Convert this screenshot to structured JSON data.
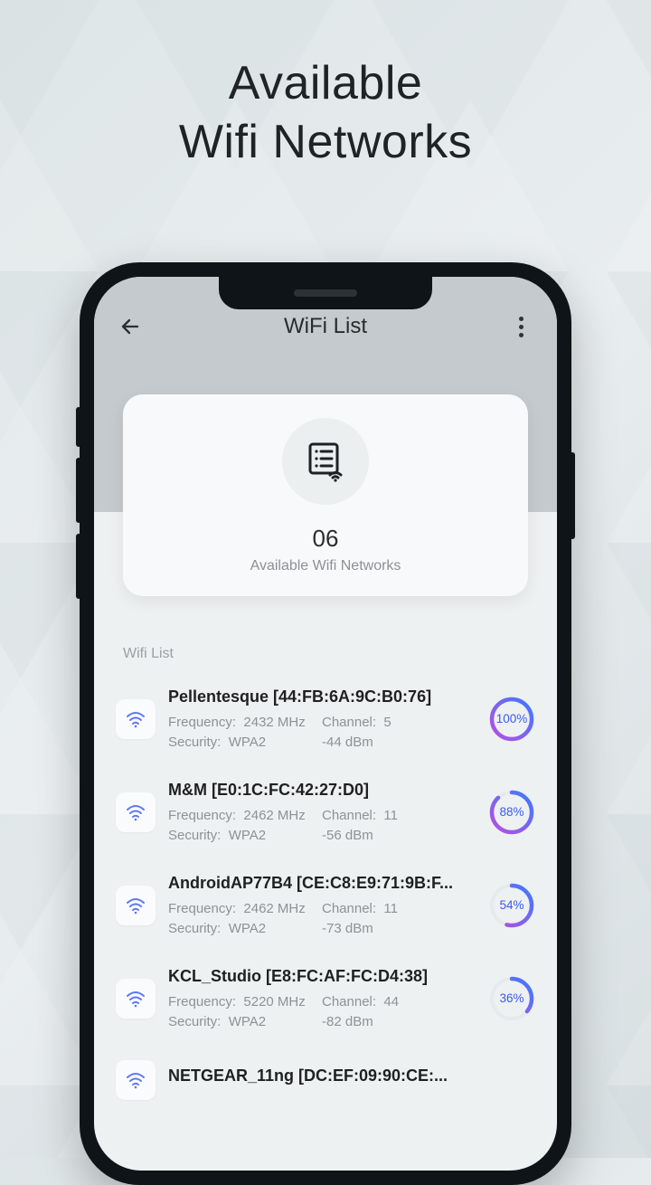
{
  "promo": {
    "line1": "Available",
    "line2": "Wifi Networks"
  },
  "appbar": {
    "title": "WiFi List"
  },
  "summary": {
    "count": "06",
    "label": "Available Wifi Networks"
  },
  "list_heading": "Wifi List",
  "labels": {
    "frequency": "Frequency:",
    "channel": "Channel:",
    "security": "Security:"
  },
  "networks": [
    {
      "name": "Pellentesque [44:FB:6A:9C:B0:76]",
      "frequency": "2432 MHz",
      "channel": "5",
      "security": "WPA2",
      "dbm": "-44 dBm",
      "signal_pct": 100
    },
    {
      "name": "M&M [E0:1C:FC:42:27:D0]",
      "frequency": "2462 MHz",
      "channel": "11",
      "security": "WPA2",
      "dbm": "-56 dBm",
      "signal_pct": 88
    },
    {
      "name": "AndroidAP77B4 [CE:C8:E9:71:9B:F...",
      "frequency": "2462 MHz",
      "channel": "11",
      "security": "WPA2",
      "dbm": "-73 dBm",
      "signal_pct": 54
    },
    {
      "name": "KCL_Studio [E8:FC:AF:FC:D4:38]",
      "frequency": "5220 MHz",
      "channel": "44",
      "security": "WPA2",
      "dbm": "-82 dBm",
      "signal_pct": 36
    },
    {
      "name": "NETGEAR_11ng [DC:EF:09:90:CE:...",
      "frequency": "",
      "channel": "",
      "security": "",
      "dbm": "",
      "signal_pct": 0
    }
  ],
  "colors": {
    "ring_grad_a": "#b94fe0",
    "ring_grad_b": "#3b7bff",
    "ring_track": "#e7eaec"
  }
}
